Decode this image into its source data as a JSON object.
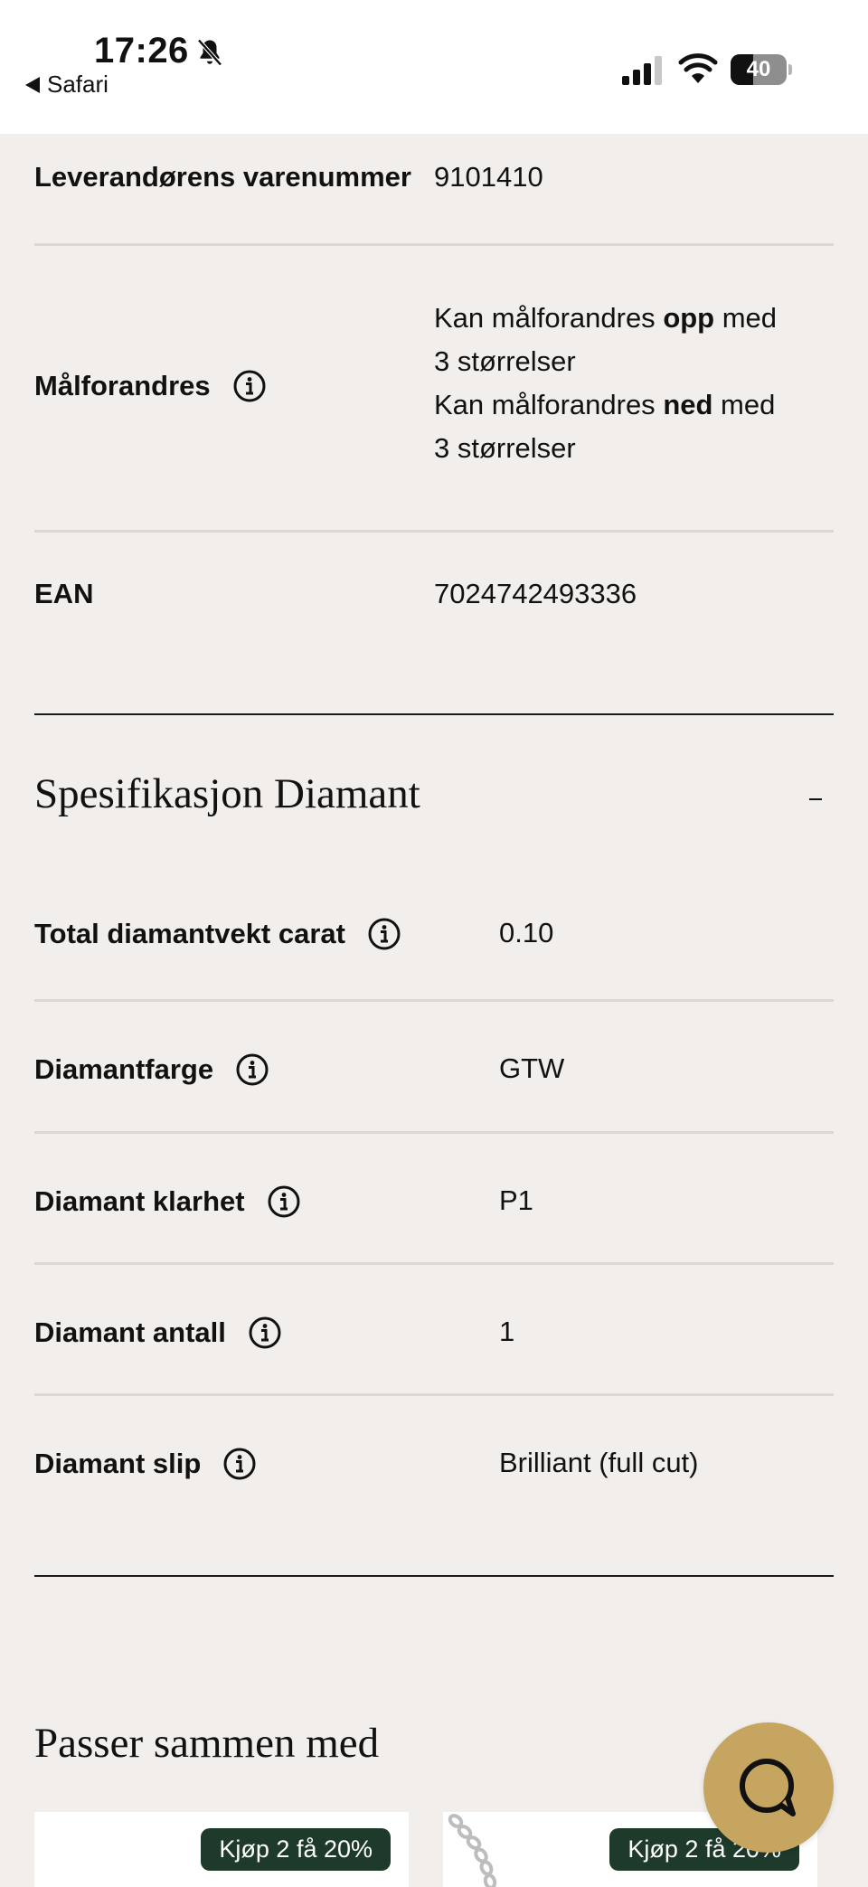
{
  "status_bar": {
    "time": "17:26",
    "back_app": "Safari",
    "battery_level": "40",
    "battery_fraction": 0.4
  },
  "product_info": [
    {
      "label": "Leverandørens varenummer",
      "value": "9101410"
    },
    {
      "label": "Målforandres",
      "value_lines": [
        {
          "prefix": "Kan målforandres ",
          "emphasis": "opp",
          "suffix": " med"
        },
        {
          "text": "3 størrelser"
        },
        {
          "prefix": "Kan målforandres ",
          "emphasis": "ned",
          "suffix": " med"
        },
        {
          "text": "3 størrelser"
        }
      ]
    },
    {
      "label": "EAN",
      "value": "7024742493336"
    }
  ],
  "diamond_section": {
    "title": "Spesifikasjon Diamant",
    "toggle_symbol": "–",
    "rows": [
      {
        "label": "Total diamantvekt carat",
        "value": "0.10"
      },
      {
        "label": "Diamantfarge",
        "value": "GTW"
      },
      {
        "label": "Diamant klarhet",
        "value": "P1"
      },
      {
        "label": "Diamant antall",
        "value": "1"
      },
      {
        "label": "Diamant slip",
        "value": "Brilliant (full cut)"
      }
    ]
  },
  "related": {
    "title": "Passer sammen med",
    "products": [
      {
        "badge": "Kjøp 2 få 20%"
      },
      {
        "badge": "Kjøp 2 få 20%"
      }
    ]
  },
  "colors": {
    "background": "#f1eeeb",
    "badge": "#1e3a2a",
    "chat_button": "#c6a560"
  },
  "icons": {
    "info": "info-circle-icon",
    "chat": "chat-bubble-icon",
    "bell": "bell-slash-icon"
  }
}
